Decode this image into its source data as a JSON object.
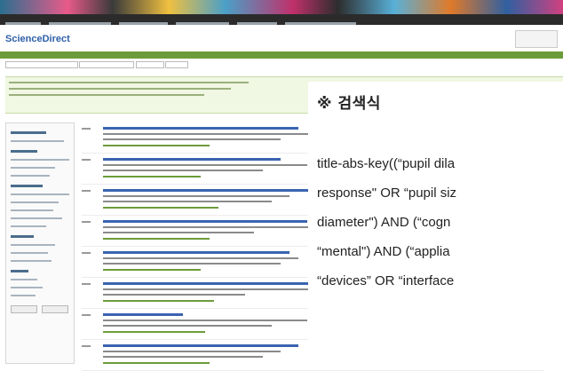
{
  "overlay": {
    "title": "※ 검색식",
    "lines": [
      "title-abs-key((“pupil dila",
      "response\" OR “pupil siz",
      "diameter\") AND (“cogn",
      "“mental\") AND (“applia",
      "“devices” OR “interface"
    ]
  }
}
